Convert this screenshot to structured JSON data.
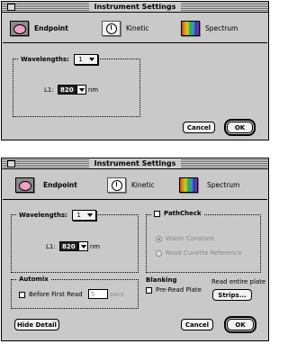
{
  "windows": [
    {
      "title": "Instrument Settings",
      "toolbar": [
        {
          "label": "Endpoint",
          "icon": "endpoint-icon",
          "selected": true
        },
        {
          "label": "Kinetic",
          "icon": "kinetic-icon",
          "selected": false
        },
        {
          "label": "Spectrum",
          "icon": "spectrum-icon",
          "selected": false
        }
      ],
      "wavelengths_label": "Wavelengths:",
      "wavelengths_value": "1",
      "l1_label": "L1:",
      "l1_value": "820",
      "l1_unit": "nm",
      "cancel_label": "Cancel",
      "ok_label": "OK"
    },
    {
      "title": "Instrument Settings",
      "toolbar": [
        {
          "label": "Endpoint",
          "icon": "endpoint-icon",
          "selected": true
        },
        {
          "label": "Kinetic",
          "icon": "kinetic-icon",
          "selected": false
        },
        {
          "label": "Spectrum",
          "icon": "spectrum-icon",
          "selected": false
        }
      ],
      "wavelengths_label": "Wavelengths:",
      "wavelengths_value": "1",
      "l1_label": "L1:",
      "l1_value": "820",
      "l1_unit": "nm",
      "pathcheck_label": "PathCheck",
      "pathcheck_checked": false,
      "water_constant_label": "Water Constant",
      "read_cuvette_label": "Read Cuvette Reference",
      "automix_label": "Automix",
      "before_first_read_label": "Before First Read",
      "automix_seconds": "5",
      "automix_unit": "secs",
      "blanking_label": "Blanking",
      "pre_read_plate_label": "Pre-Read Plate",
      "read_entire_plate_label": "Read entire plate",
      "strips_label": "Strips...",
      "hide_detail_label": "Hide Detail",
      "cancel_label": "Cancel",
      "ok_label": "OK"
    }
  ],
  "colors": {
    "window_bg": "#c9c9c9",
    "endpoint_accent": "#f0a0c4"
  }
}
